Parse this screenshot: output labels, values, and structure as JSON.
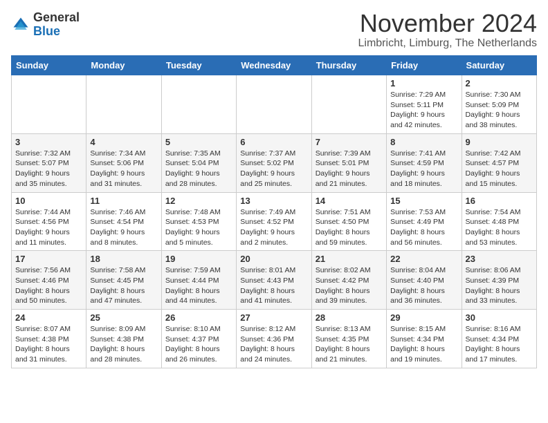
{
  "logo": {
    "general": "General",
    "blue": "Blue"
  },
  "header": {
    "month": "November 2024",
    "location": "Limbricht, Limburg, The Netherlands"
  },
  "weekdays": [
    "Sunday",
    "Monday",
    "Tuesday",
    "Wednesday",
    "Thursday",
    "Friday",
    "Saturday"
  ],
  "weeks": [
    [
      {
        "day": "",
        "info": ""
      },
      {
        "day": "",
        "info": ""
      },
      {
        "day": "",
        "info": ""
      },
      {
        "day": "",
        "info": ""
      },
      {
        "day": "",
        "info": ""
      },
      {
        "day": "1",
        "info": "Sunrise: 7:29 AM\nSunset: 5:11 PM\nDaylight: 9 hours and 42 minutes."
      },
      {
        "day": "2",
        "info": "Sunrise: 7:30 AM\nSunset: 5:09 PM\nDaylight: 9 hours and 38 minutes."
      }
    ],
    [
      {
        "day": "3",
        "info": "Sunrise: 7:32 AM\nSunset: 5:07 PM\nDaylight: 9 hours and 35 minutes."
      },
      {
        "day": "4",
        "info": "Sunrise: 7:34 AM\nSunset: 5:06 PM\nDaylight: 9 hours and 31 minutes."
      },
      {
        "day": "5",
        "info": "Sunrise: 7:35 AM\nSunset: 5:04 PM\nDaylight: 9 hours and 28 minutes."
      },
      {
        "day": "6",
        "info": "Sunrise: 7:37 AM\nSunset: 5:02 PM\nDaylight: 9 hours and 25 minutes."
      },
      {
        "day": "7",
        "info": "Sunrise: 7:39 AM\nSunset: 5:01 PM\nDaylight: 9 hours and 21 minutes."
      },
      {
        "day": "8",
        "info": "Sunrise: 7:41 AM\nSunset: 4:59 PM\nDaylight: 9 hours and 18 minutes."
      },
      {
        "day": "9",
        "info": "Sunrise: 7:42 AM\nSunset: 4:57 PM\nDaylight: 9 hours and 15 minutes."
      }
    ],
    [
      {
        "day": "10",
        "info": "Sunrise: 7:44 AM\nSunset: 4:56 PM\nDaylight: 9 hours and 11 minutes."
      },
      {
        "day": "11",
        "info": "Sunrise: 7:46 AM\nSunset: 4:54 PM\nDaylight: 9 hours and 8 minutes."
      },
      {
        "day": "12",
        "info": "Sunrise: 7:48 AM\nSunset: 4:53 PM\nDaylight: 9 hours and 5 minutes."
      },
      {
        "day": "13",
        "info": "Sunrise: 7:49 AM\nSunset: 4:52 PM\nDaylight: 9 hours and 2 minutes."
      },
      {
        "day": "14",
        "info": "Sunrise: 7:51 AM\nSunset: 4:50 PM\nDaylight: 8 hours and 59 minutes."
      },
      {
        "day": "15",
        "info": "Sunrise: 7:53 AM\nSunset: 4:49 PM\nDaylight: 8 hours and 56 minutes."
      },
      {
        "day": "16",
        "info": "Sunrise: 7:54 AM\nSunset: 4:48 PM\nDaylight: 8 hours and 53 minutes."
      }
    ],
    [
      {
        "day": "17",
        "info": "Sunrise: 7:56 AM\nSunset: 4:46 PM\nDaylight: 8 hours and 50 minutes."
      },
      {
        "day": "18",
        "info": "Sunrise: 7:58 AM\nSunset: 4:45 PM\nDaylight: 8 hours and 47 minutes."
      },
      {
        "day": "19",
        "info": "Sunrise: 7:59 AM\nSunset: 4:44 PM\nDaylight: 8 hours and 44 minutes."
      },
      {
        "day": "20",
        "info": "Sunrise: 8:01 AM\nSunset: 4:43 PM\nDaylight: 8 hours and 41 minutes."
      },
      {
        "day": "21",
        "info": "Sunrise: 8:02 AM\nSunset: 4:42 PM\nDaylight: 8 hours and 39 minutes."
      },
      {
        "day": "22",
        "info": "Sunrise: 8:04 AM\nSunset: 4:40 PM\nDaylight: 8 hours and 36 minutes."
      },
      {
        "day": "23",
        "info": "Sunrise: 8:06 AM\nSunset: 4:39 PM\nDaylight: 8 hours and 33 minutes."
      }
    ],
    [
      {
        "day": "24",
        "info": "Sunrise: 8:07 AM\nSunset: 4:38 PM\nDaylight: 8 hours and 31 minutes."
      },
      {
        "day": "25",
        "info": "Sunrise: 8:09 AM\nSunset: 4:38 PM\nDaylight: 8 hours and 28 minutes."
      },
      {
        "day": "26",
        "info": "Sunrise: 8:10 AM\nSunset: 4:37 PM\nDaylight: 8 hours and 26 minutes."
      },
      {
        "day": "27",
        "info": "Sunrise: 8:12 AM\nSunset: 4:36 PM\nDaylight: 8 hours and 24 minutes."
      },
      {
        "day": "28",
        "info": "Sunrise: 8:13 AM\nSunset: 4:35 PM\nDaylight: 8 hours and 21 minutes."
      },
      {
        "day": "29",
        "info": "Sunrise: 8:15 AM\nSunset: 4:34 PM\nDaylight: 8 hours and 19 minutes."
      },
      {
        "day": "30",
        "info": "Sunrise: 8:16 AM\nSunset: 4:34 PM\nDaylight: 8 hours and 17 minutes."
      }
    ]
  ]
}
